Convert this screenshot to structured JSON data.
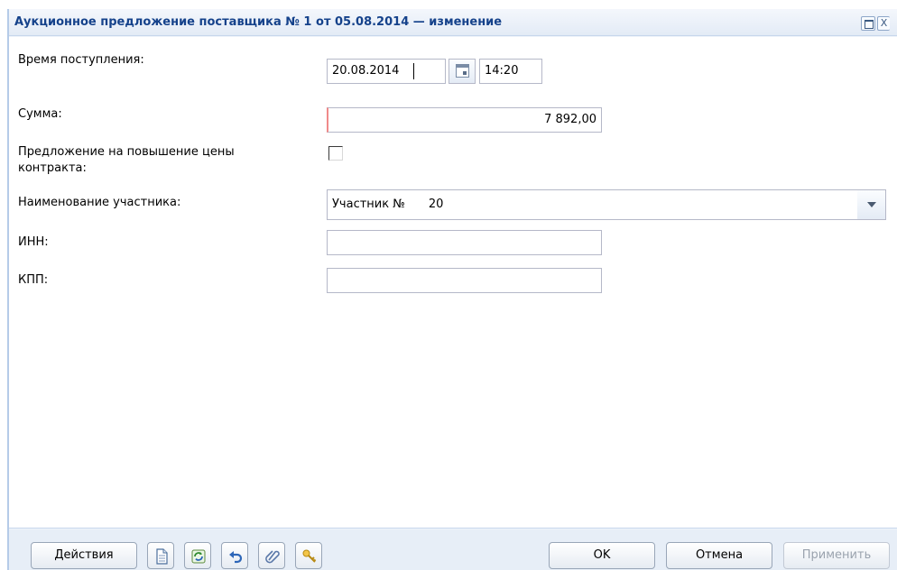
{
  "window": {
    "title": "Аукционное предложение поставщика № 1 от 05.08.2014 — изменение",
    "maximize_glyph": "□",
    "close_glyph": "X"
  },
  "form": {
    "receipt_time": {
      "label": "Время поступления:",
      "date": "20.08.2014",
      "time": "14:20"
    },
    "amount": {
      "label": "Сумма:",
      "value": "7 892,00"
    },
    "price_increase": {
      "label_line1": "Предложение на повышение цены",
      "label_line2": "контракта:",
      "checked": false
    },
    "participant": {
      "label": "Наименование участника:",
      "value": "Участник №",
      "number": "20"
    },
    "inn": {
      "label": "ИНН:",
      "value": ""
    },
    "kpp": {
      "label": "КПП:",
      "value": ""
    }
  },
  "footer": {
    "actions_label": "Действия",
    "icons": [
      "document-icon",
      "refresh-icon",
      "undo-icon",
      "attach-icon",
      "key-icon"
    ],
    "ok_label": "OK",
    "cancel_label": "Отмена",
    "apply_label": "Применить"
  },
  "colors": {
    "title_text": "#15428b",
    "required_marker": "#f08a8a",
    "panel_bg": "#e7eef7"
  }
}
